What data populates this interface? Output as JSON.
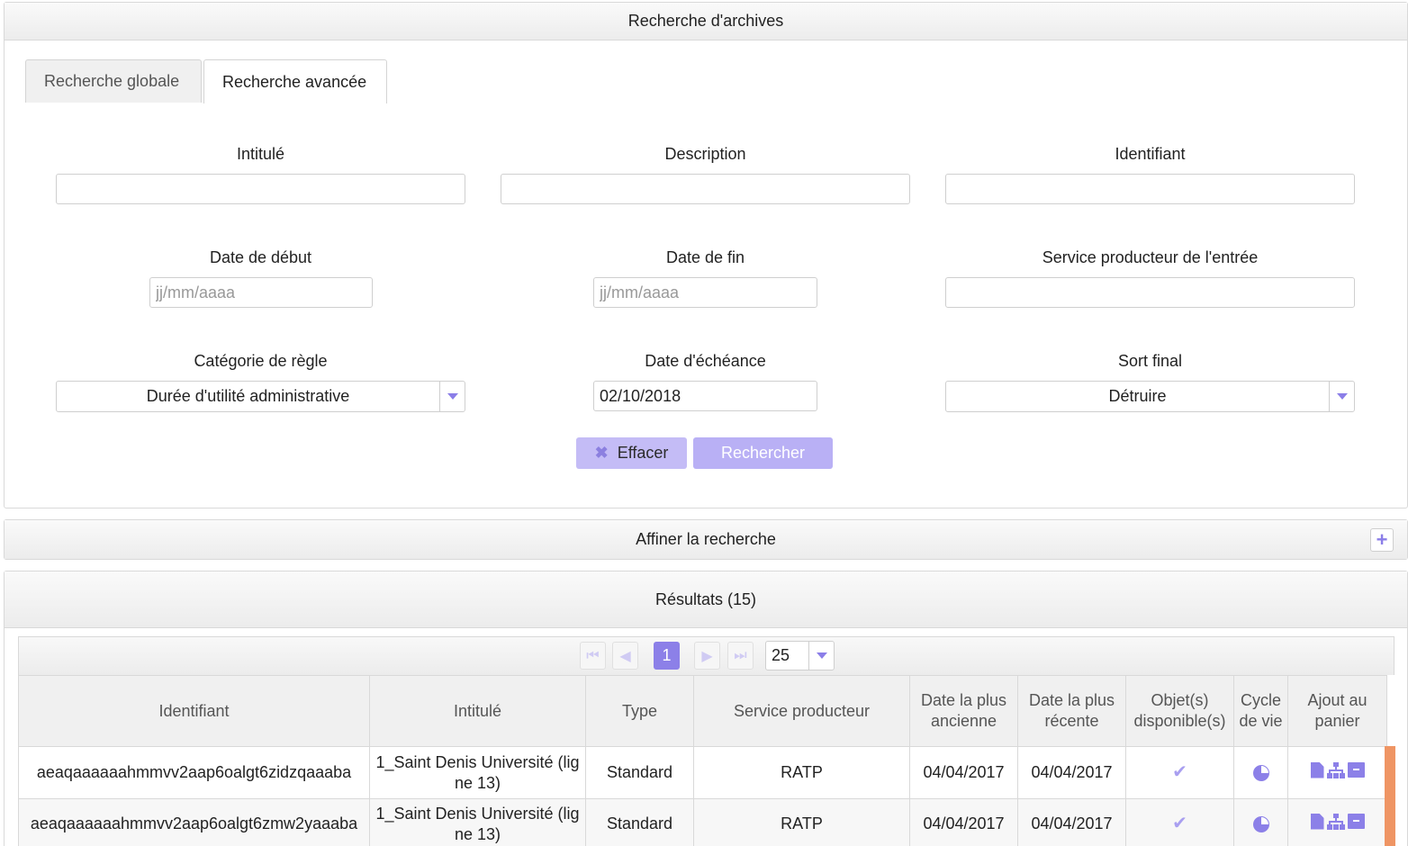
{
  "search_panel": {
    "title": "Recherche d'archives",
    "tabs": [
      {
        "label": "Recherche globale",
        "active": false
      },
      {
        "label": "Recherche avancée",
        "active": true
      }
    ],
    "fields": {
      "intitule_label": "Intitulé",
      "description_label": "Description",
      "identifiant_label": "Identifiant",
      "date_debut_label": "Date de début",
      "date_debut_placeholder": "jj/mm/aaaa",
      "date_fin_label": "Date de fin",
      "date_fin_placeholder": "jj/mm/aaaa",
      "service_label": "Service producteur de l'entrée",
      "categorie_label": "Catégorie de règle",
      "categorie_value": "Durée d'utilité administrative",
      "echeance_label": "Date d'échéance",
      "echeance_value": "02/10/2018",
      "sort_final_label": "Sort final",
      "sort_final_value": "Détruire"
    },
    "buttons": {
      "clear_label": "Effacer",
      "search_label": "Rechercher"
    }
  },
  "refine_panel": {
    "title": "Affiner la recherche",
    "toggle_glyph": "+"
  },
  "results_panel": {
    "title": "Résultats (15)",
    "pager": {
      "current_page": "1",
      "page_size": "25"
    },
    "columns": [
      "Identifiant",
      "Intitulé",
      "Type",
      "Service producteur",
      "Date la plus ancienne",
      "Date la plus récente",
      "Objet(s) disponible(s)",
      "Cycle de vie",
      "Ajout au panier"
    ],
    "rows": [
      {
        "identifiant": "aeaqaaaaaahmmvv2aap6oalgt6zidzqaaaba",
        "intitule": "1_Saint Denis Université (ligne 13)",
        "type": "Standard",
        "service": "RATP",
        "date_ancienne": "04/04/2017",
        "date_recente": "04/04/2017"
      },
      {
        "identifiant": "aeaqaaaaaahmmvv2aap6oalgt6zmw2yaaaba",
        "intitule": "1_Saint Denis Université (ligne 13)",
        "type": "Standard",
        "service": "RATP",
        "date_ancienne": "04/04/2017",
        "date_recente": "04/04/2017"
      }
    ]
  },
  "colors": {
    "accent": "#8c80e8",
    "button": "#b9b0f5",
    "scroll_marker": "#ef9564"
  },
  "icons": [
    "close-icon",
    "plus-icon",
    "first-page-icon",
    "prev-page-icon",
    "next-page-icon",
    "last-page-icon",
    "chevron-down-icon",
    "check-icon",
    "pie-chart-icon",
    "document-icon",
    "tree-icon",
    "archive-box-icon"
  ]
}
